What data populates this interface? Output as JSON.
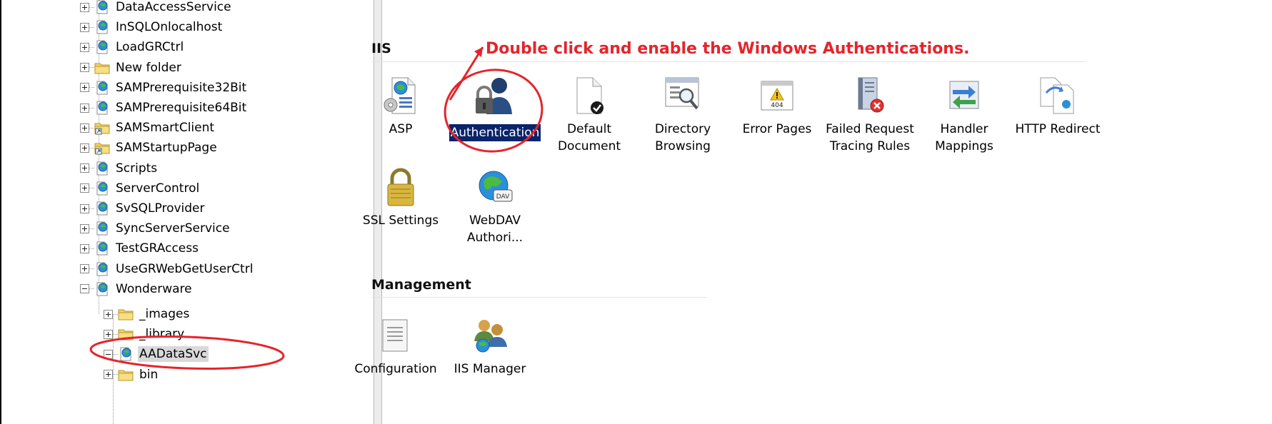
{
  "tree": {
    "items": [
      {
        "label": "DataAccessService",
        "icon": "web-app-icon",
        "expand": "plus"
      },
      {
        "label": "InSQLOnlocalhost",
        "icon": "web-app-icon",
        "expand": "plus"
      },
      {
        "label": "LoadGRCtrl",
        "icon": "web-app-icon",
        "expand": "plus"
      },
      {
        "label": "New folder",
        "icon": "folder-icon",
        "expand": "plus"
      },
      {
        "label": "SAMPrerequisite32Bit",
        "icon": "web-app-icon",
        "expand": "plus"
      },
      {
        "label": "SAMPrerequisite64Bit",
        "icon": "web-app-icon",
        "expand": "plus"
      },
      {
        "label": "SAMSmartClient",
        "icon": "folder-shortcut-icon",
        "expand": "plus"
      },
      {
        "label": "SAMStartupPage",
        "icon": "folder-shortcut-icon",
        "expand": "plus"
      },
      {
        "label": "Scripts",
        "icon": "web-app-icon",
        "expand": "plus"
      },
      {
        "label": "ServerControl",
        "icon": "web-app-icon",
        "expand": "plus"
      },
      {
        "label": "SvSQLProvider",
        "icon": "web-app-icon",
        "expand": "plus"
      },
      {
        "label": "SyncServerService",
        "icon": "web-app-icon",
        "expand": "plus"
      },
      {
        "label": "TestGRAccess",
        "icon": "web-app-icon",
        "expand": "plus"
      },
      {
        "label": "UseGRWebGetUserCtrl",
        "icon": "web-app-icon",
        "expand": "plus"
      },
      {
        "label": "Wonderware",
        "icon": "web-app-icon",
        "expand": "minus"
      }
    ],
    "children": [
      {
        "label": "_images",
        "icon": "folder-icon",
        "expand": "plus"
      },
      {
        "label": "_library",
        "icon": "folder-icon",
        "expand": "plus"
      },
      {
        "label": "AADataSvc",
        "icon": "web-app-icon",
        "expand": "minus",
        "selected": true
      },
      {
        "label": "bin",
        "icon": "folder-icon",
        "expand": "plus"
      }
    ]
  },
  "groups": {
    "iis": "IIS",
    "management": "Management"
  },
  "features": {
    "asp": "ASP",
    "authentication": "Authentication",
    "default_document": "Default Document",
    "directory_browsing": "Directory Browsing",
    "error_pages": "Error Pages",
    "failed_request": "Failed Request Tracing Rules",
    "handler_mappings": "Handler Mappings",
    "http_redirect": "HTTP Redirect",
    "ssl_settings": "SSL Settings",
    "webdav": "WebDAV Authori...",
    "configuration": "Configuration",
    "iis_manager": "IIS Manager"
  },
  "annotation": {
    "text": "Double click and enable the Windows Authentications.",
    "color": "#e5242b"
  },
  "colors": {
    "selection": "#0a246a",
    "tree_selection": "#d9d9d9"
  }
}
